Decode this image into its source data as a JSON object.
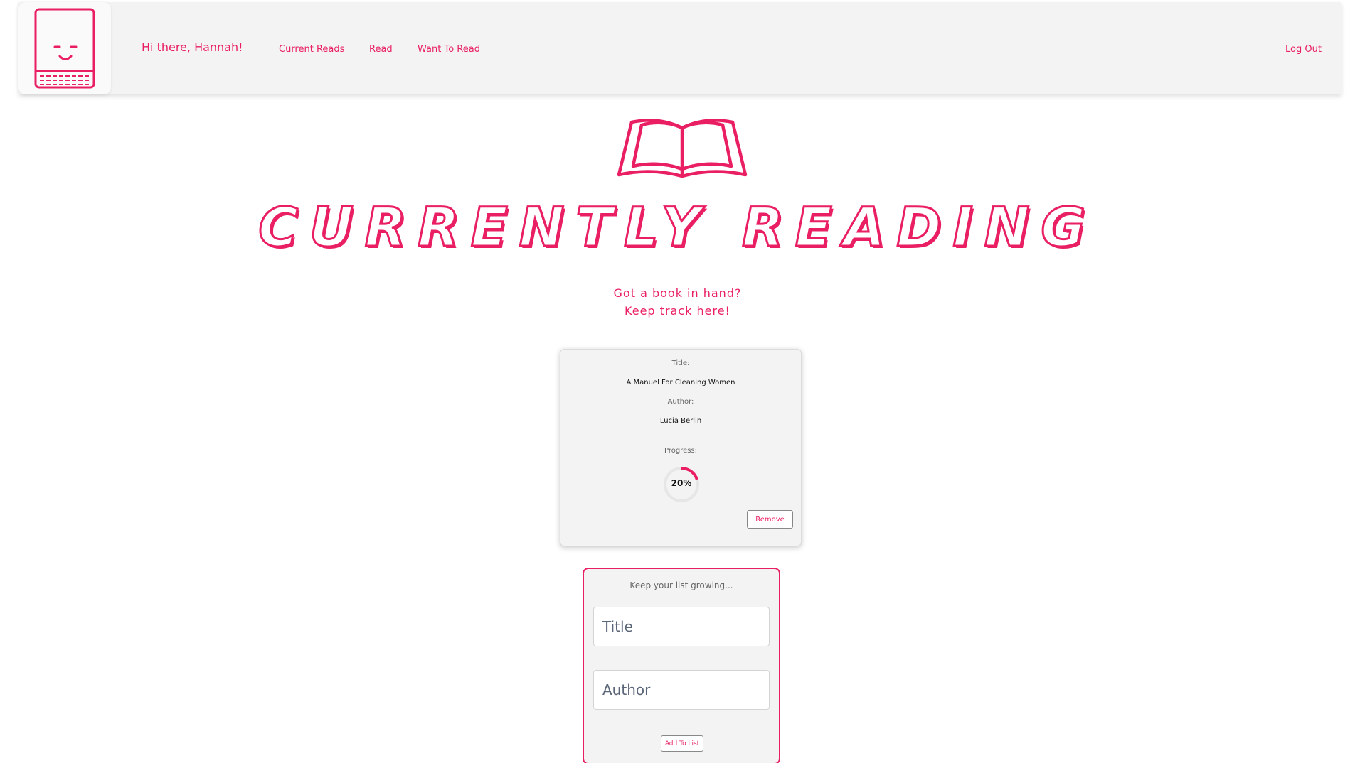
{
  "nav": {
    "greeting": "Hi there, Hannah!",
    "links": {
      "current_reads": "Current Reads",
      "read": "Read",
      "want_to_read": "Want To Read"
    },
    "logout": "Log Out",
    "logo_icon": "smiling-book-icon"
  },
  "hero": {
    "icon": "open-book-icon",
    "headline": "CURRENTLY READING",
    "tagline_line1": "Got a book in hand?",
    "tagline_line2": "Keep track here!"
  },
  "book_card": {
    "title_label": "Title:",
    "title": "A Manuel For Cleaning Women",
    "author_label": "Author:",
    "author": "Lucia Berlin",
    "progress_label": "Progress:",
    "progress_percent": 20,
    "progress_text": "20%",
    "remove_label": "Remove"
  },
  "add_form": {
    "heading": "Keep your list growing...",
    "title_placeholder": "Title",
    "title_value": "",
    "author_placeholder": "Author",
    "author_value": "",
    "submit_label": "Add To List"
  },
  "colors": {
    "accent": "#e91e63",
    "navbar_bg": "#f3f3f3",
    "card_bg": "#f3f3f3",
    "ring_track": "#e6e6e6"
  }
}
